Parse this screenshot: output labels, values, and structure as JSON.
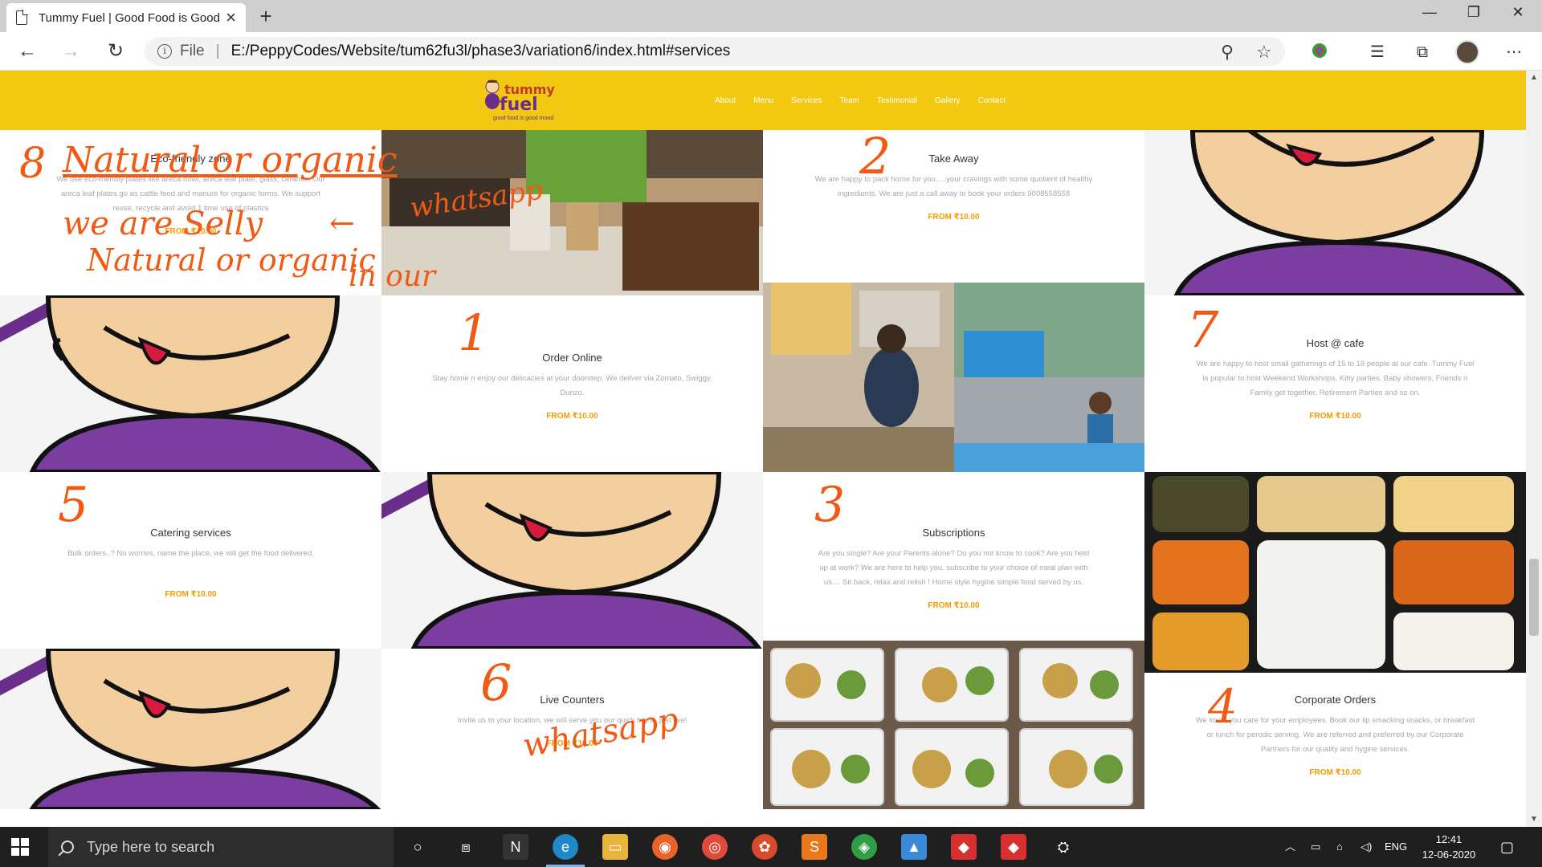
{
  "browser": {
    "tab_title": "Tummy Fuel | Good Food is Good Mood",
    "url_scheme": "File",
    "url": "E:/PeppyCodes/Website/tum62fu3l/phase3/variation6/index.html#services"
  },
  "site": {
    "logo_word1": "tummy",
    "logo_word2": "fuel",
    "tagline": "good food is good mood",
    "nav": [
      "About",
      "Menu",
      "Services",
      "Team",
      "Testimonial",
      "Gallery",
      "Contact"
    ]
  },
  "services": {
    "eco": {
      "title": "Eco-friendly zone",
      "description": "We use eco-friendly plates like areca bowl, areca leaf plate, glass, ceramic. Our areca leaf plates go as cattle feed and manure for organic forms. We support reuse, recycle and avoid 1 time use of plastics",
      "price": "FROM ₹10.00"
    },
    "take_away": {
      "title": "Take Away",
      "description": "We are happy to pack home for you.....your cravings with some quotient of healthy ingredients. We are just a call away to book your orders 9008558558",
      "price": "FROM ₹10.00"
    },
    "order_online": {
      "title": "Order Online",
      "description": "Stay home n enjoy our delicacies at your doorstep. We deliver via Zomato, Swiggy, Dunzo.",
      "price": "FROM ₹10.00"
    },
    "host": {
      "title": "Host @ cafe",
      "description": "We are happy to host small gatherings of 15 to 18 people at our cafe. Tummy Fuel is popular to host Weekend Workshops, Kitty parties, Baby showers, Friends n Family get together, Retirement Parties and so on.",
      "price": "FROM ₹10.00"
    },
    "catering": {
      "title": "Catering services",
      "description": "Bulk orders..? No worries, name the place, we will get the food delivered.",
      "price": "FROM ₹10.00"
    },
    "subscriptions": {
      "title": "Subscriptions",
      "description": "Are you single? Are your Parents alone? Do you not know to cook? Are you held up at work? We are here to help you. subscribe to your choice of meal plan with us.... Sit back, relax and relish ! Home style hygine simple food served by us.",
      "price": "FROM ₹10.00"
    },
    "live_counters": {
      "title": "Live Counters",
      "description": "Invite us to your location, we will serve you our quick bites...just live!",
      "price": "FROM ₹10.00"
    },
    "corporate": {
      "title": "Corporate Orders",
      "description": "We know you care for your employees. Book our lip smacking snacks, or breakfast or lunch for perodic serving. We are referred and preferred by our Corporate Partners for our quality and hygine services.",
      "price": "FROM ₹10.00"
    }
  },
  "annotations": {
    "n8": "8",
    "n2": "2",
    "n1": "1",
    "n7": "7",
    "n5": "5",
    "n3": "3",
    "n6": "6",
    "n4": "4",
    "natural": "Natural or organic",
    "whatsapp1": "whatsapp",
    "we_are": "we are Selly",
    "natural2": "Natural or organic",
    "in_our": "in our",
    "whatsapp2": "whatsapp"
  },
  "taskbar": {
    "search_placeholder": "Type here to search",
    "language": "ENG",
    "time": "12:41",
    "date": "12-06-2020"
  },
  "colors": {
    "header_yellow": "#f2c811",
    "price_orange": "#f59b00",
    "annotation_orange": "#f05a14",
    "mascot_purple": "#6b2d8a"
  }
}
